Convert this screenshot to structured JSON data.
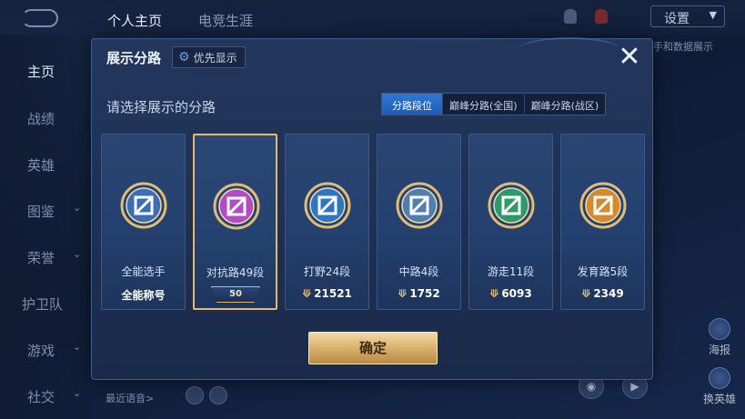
{
  "background": {
    "tabs": [
      "个人主页",
      "电竞生涯"
    ],
    "settings_label": "设置",
    "sidebar": [
      {
        "label": "主页",
        "active": true
      },
      {
        "label": "战绩",
        "active": false
      },
      {
        "label": "英雄",
        "active": false
      },
      {
        "label": "图鉴",
        "active": false
      },
      {
        "label": "荣誉",
        "active": false
      },
      {
        "label": "护卫队",
        "active": false
      },
      {
        "label": "游戏",
        "active": false
      },
      {
        "label": "社交",
        "active": false
      }
    ],
    "right_hint": "手和数据展示",
    "recent_label": "最近语音>",
    "right_buttons": [
      "海报",
      "换英雄"
    ]
  },
  "modal": {
    "title": "展示分路",
    "priority_label": "优先显示",
    "subtitle": "请选择展示的分路",
    "segments": [
      {
        "label": "分路段位",
        "active": true
      },
      {
        "label": "巅峰分路(全国)",
        "active": false
      },
      {
        "label": "巅峰分路(战区)",
        "active": false
      }
    ],
    "cards": [
      {
        "name": "全能选手",
        "stat": "全能称号",
        "stat_icon": false,
        "selected": false,
        "badge_color": "#3a6fb8",
        "badge_icon": "allround-icon"
      },
      {
        "name": "对抗路49段",
        "stat": "50",
        "stat_icon": false,
        "selected": true,
        "badge_color": "#b24bc9",
        "badge_icon": "clash-lane-icon"
      },
      {
        "name": "打野24段",
        "stat": "21521",
        "stat_icon": true,
        "selected": false,
        "badge_color": "#2f76c2",
        "badge_icon": "jungle-icon"
      },
      {
        "name": "中路4段",
        "stat": "1752",
        "stat_icon": true,
        "selected": false,
        "badge_color": "#4f7fb0",
        "badge_icon": "mid-lane-icon"
      },
      {
        "name": "游走11段",
        "stat": "6093",
        "stat_icon": true,
        "selected": false,
        "badge_color": "#2c9a6a",
        "badge_icon": "roam-icon"
      },
      {
        "name": "发育路5段",
        "stat": "2349",
        "stat_icon": true,
        "selected": false,
        "badge_color": "#d58b2c",
        "badge_icon": "farm-lane-icon"
      }
    ],
    "confirm_label": "确定"
  }
}
